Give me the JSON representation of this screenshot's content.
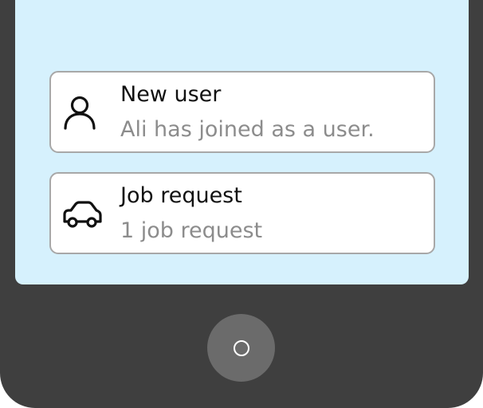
{
  "notifications": [
    {
      "icon": "user-icon",
      "title": "New user",
      "body": "Ali has joined as a user."
    },
    {
      "icon": "car-icon",
      "title": "Job request",
      "body": "1 job request"
    }
  ],
  "home_button": {
    "icon": "home-circle-icon"
  },
  "colors": {
    "screen_background": "#d6f1fd",
    "phone_frame": "#3f3f3f",
    "card_border": "#a8a8a8",
    "title_text": "#111111",
    "body_text": "#8c8c8c",
    "home_button": "#6b6b6b"
  }
}
